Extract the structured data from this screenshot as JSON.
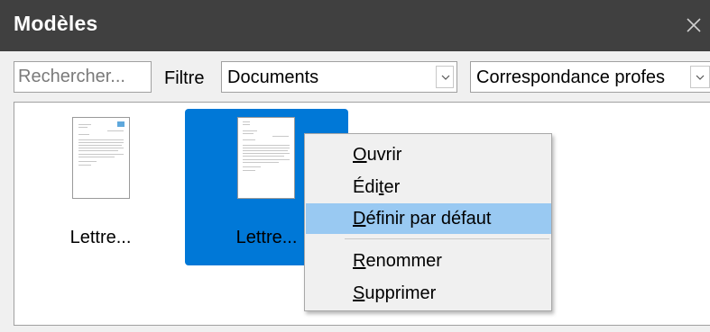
{
  "window": {
    "title": "Modèles"
  },
  "filter": {
    "search_placeholder": "Rechercher...",
    "label": "Filtre",
    "type_value": "Documents",
    "category_value": "Correspondance profes"
  },
  "templates": [
    {
      "label": "Lettre..."
    },
    {
      "label": "Lettre..."
    }
  ],
  "menu": {
    "items": [
      {
        "mn": "O",
        "rest": "uvrir"
      },
      {
        "pre": "Édi",
        "mn": "t",
        "post": "er"
      },
      {
        "mn": "D",
        "rest": "éfinir par défaut"
      },
      {
        "mn": "R",
        "rest": "enommer"
      },
      {
        "mn": "S",
        "rest": "upprimer"
      }
    ]
  },
  "colors": {
    "titlebar": "#404040",
    "selection": "#0078d7",
    "menu_highlight": "#99c9f2"
  },
  "icons": [
    "close-icon",
    "chevron-down-icon",
    "document-thumbnail-icon"
  ]
}
